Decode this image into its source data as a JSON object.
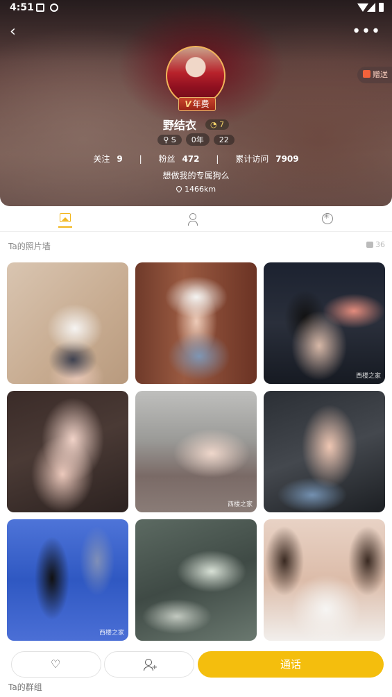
{
  "statusbar": {
    "time": "4:51"
  },
  "profile": {
    "name": "野结衣",
    "vip_label": "年费",
    "level": "7",
    "tags": [
      "S",
      "0年",
      "22"
    ],
    "stats": [
      {
        "label": "关注",
        "value": "9"
      },
      {
        "label": "粉丝",
        "value": "472"
      },
      {
        "label": "累计访问",
        "value": "7909"
      }
    ],
    "separator": "|",
    "bio": "想做我的专属狗么",
    "distance": "1466km",
    "gift_label": "赠送"
  },
  "tabs": [
    "photos-icon",
    "profile-icon",
    "moments-icon"
  ],
  "photo_wall": {
    "title": "Ta的照片墙",
    "likes": "36",
    "watermark": "西楼之家"
  },
  "actions": {
    "call_label": "通话"
  },
  "groups": {
    "title": "Ta的群组"
  },
  "colors": {
    "accent": "#f4be0d",
    "vip": "#c9452b"
  }
}
